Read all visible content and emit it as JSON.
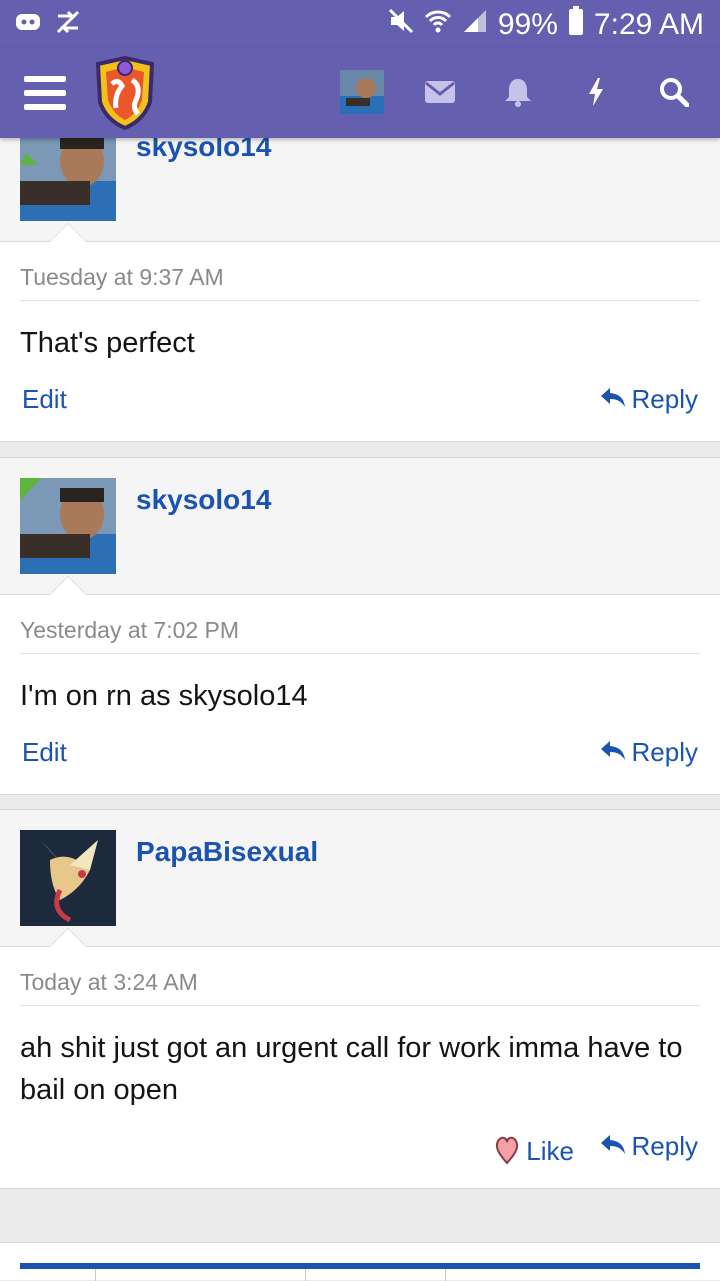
{
  "status_bar": {
    "battery": "99%",
    "time": "7:29 AM"
  },
  "topbar": {
    "icons": [
      "menu-icon",
      "forum-logo",
      "user-avatar",
      "mail-icon",
      "bell-icon",
      "bolt-icon",
      "search-icon"
    ]
  },
  "posts": [
    {
      "author": "skysolo14",
      "timestamp": "Tuesday at 9:37 AM",
      "message": "That's perfect",
      "edit_label": "Edit",
      "reply_label": "Reply"
    },
    {
      "author": "skysolo14",
      "timestamp": "Yesterday at 7:02 PM",
      "message": "I'm on rn as skysolo14",
      "edit_label": "Edit",
      "reply_label": "Reply"
    },
    {
      "author": "PapaBisexual",
      "timestamp": "Today at 3:24 AM",
      "message": "ah shit just got an urgent call for work imma have to bail on open",
      "like_label": "Like",
      "reply_label": "Reply"
    }
  ],
  "colors": {
    "header": "#655fb0",
    "link": "#1a54b0"
  }
}
